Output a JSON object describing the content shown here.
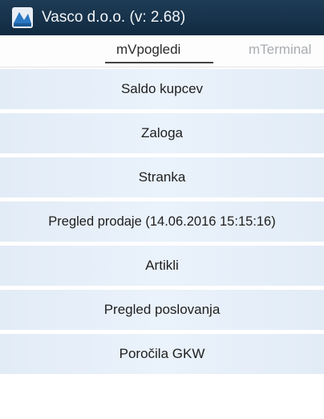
{
  "window": {
    "title": "Vasco d.o.o. (v: 2.68)",
    "icon": "vasco-logo-icon"
  },
  "tabs": [
    {
      "label": "mVpogledi",
      "active": true
    },
    {
      "label": "mTerminal",
      "active": false
    }
  ],
  "menu": {
    "items": [
      {
        "label": "Saldo kupcev"
      },
      {
        "label": "Zaloga"
      },
      {
        "label": "Stranka"
      },
      {
        "label": "Pregled prodaje (14.06.2016 15:15:16)"
      },
      {
        "label": "Artikli"
      },
      {
        "label": "Pregled poslovanja"
      },
      {
        "label": "Poročila GKW"
      }
    ]
  },
  "colors": {
    "titlebar": "#1a354d",
    "menu_item_bg": "#e6eff9",
    "tab_active_text": "#2a2a2a",
    "tab_inactive_text": "#a8adb2"
  }
}
